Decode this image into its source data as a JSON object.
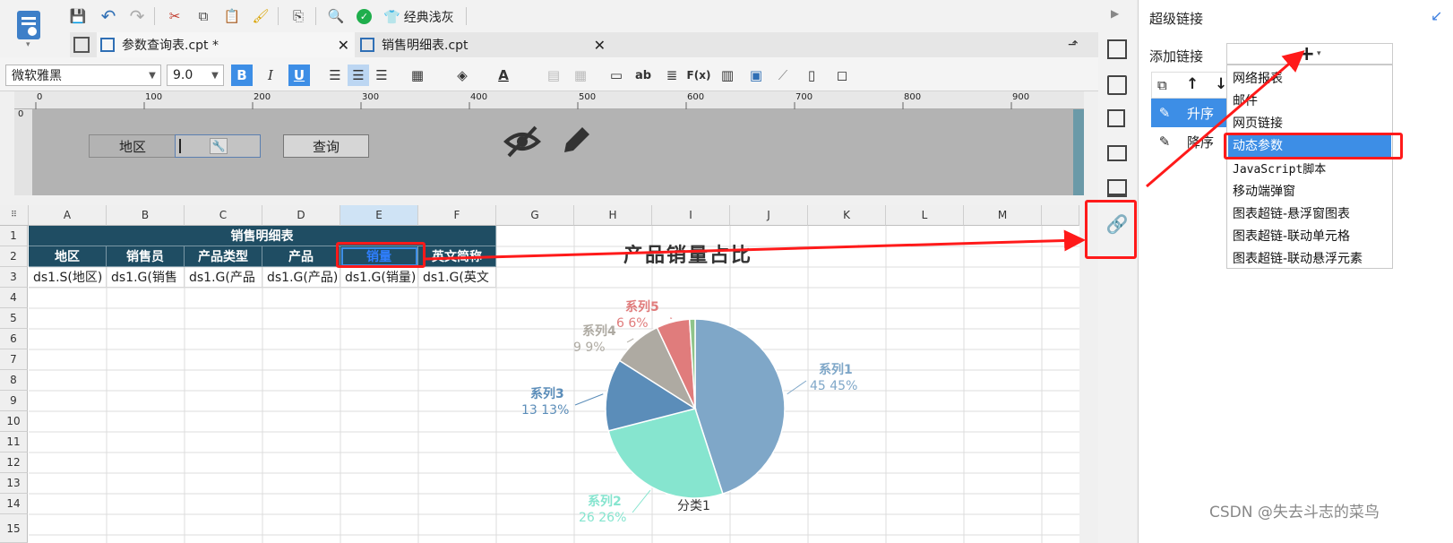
{
  "toolbar": {
    "theme_label": "经典浅灰"
  },
  "tabs": [
    {
      "label": "参数查询表.cpt *"
    },
    {
      "label": "销售明细表.cpt"
    }
  ],
  "format": {
    "font_name": "微软雅黑",
    "font_size": "9.0",
    "bold": "B",
    "italic": "I",
    "underline": "U",
    "text_ab": "ab",
    "formula": "F(x)"
  },
  "ruler": {
    "ticks": [
      "0",
      "100",
      "200",
      "300",
      "400",
      "500",
      "600",
      "700",
      "800",
      "900"
    ],
    "vzero": "0"
  },
  "param_panel": {
    "region_label": "地区",
    "query_button": "查询"
  },
  "grid": {
    "columns": [
      "A",
      "B",
      "C",
      "D",
      "E",
      "F",
      "G",
      "H",
      "I",
      "J",
      "K",
      "L",
      "M"
    ],
    "rows": [
      "1",
      "2",
      "3",
      "4",
      "5",
      "6",
      "7",
      "8",
      "9",
      "10",
      "11",
      "12",
      "13",
      "14",
      "15"
    ],
    "title": "销售明细表",
    "headers": [
      "地区",
      "销售员",
      "产品类型",
      "产品",
      "销量",
      "英文简称"
    ],
    "bindings": [
      "ds1.S(地区)",
      "ds1.G(销售",
      "ds1.G(产品",
      "ds1.G(产品)",
      "ds1.G(销量)",
      "ds1.G(英文"
    ]
  },
  "chart_data": {
    "type": "pie",
    "title": "产品销量占比",
    "category_label": "分类1",
    "series": [
      {
        "name": "系列1",
        "value": 45,
        "percent": "45%",
        "color": "#7fa7c8",
        "label": "45  45%"
      },
      {
        "name": "系列2",
        "value": 26,
        "percent": "26%",
        "color": "#86e5cf",
        "label": "26  26%"
      },
      {
        "name": "系列3",
        "value": 13,
        "percent": "13%",
        "color": "#5b8db9",
        "label": "13  13%"
      },
      {
        "name": "系列4",
        "value": 9,
        "percent": "9%",
        "color": "#aeaaa2",
        "label": "9  9%"
      },
      {
        "name": "系列5",
        "value": 6,
        "percent": "6%",
        "color": "#e07c7c",
        "label": "6  6%"
      },
      {
        "name": "",
        "value": 1,
        "percent": "",
        "color": "#8fc48a",
        "label": ""
      }
    ]
  },
  "right_panel": {
    "title": "超级链接",
    "add_link_label": "添加链接",
    "add_button": "+",
    "list": [
      "升序",
      "降序"
    ],
    "menu": [
      "网络报表",
      "邮件",
      "网页链接",
      "动态参数",
      "JavaScript脚本",
      "移动端弹窗",
      "图表超链-悬浮窗图表",
      "图表超链-联动单元格",
      "图表超链-联动悬浮元素"
    ],
    "highlighted_menu": "动态参数"
  },
  "watermark": "CSDN @失去斗志的菜鸟",
  "colors": {
    "header_bg": "#1f4d63",
    "accent": "#3d8ee6",
    "annotation": "#ff1a1a"
  }
}
